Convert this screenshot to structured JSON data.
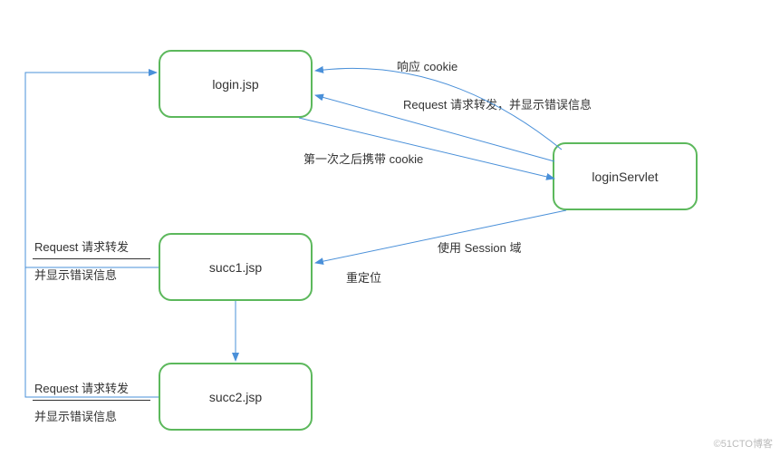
{
  "nodes": {
    "login": "login.jsp",
    "servlet": "loginServlet",
    "succ1": "succ1.jsp",
    "succ2": "succ2.jsp"
  },
  "labels": {
    "responseCookie": "响应 cookie",
    "requestForwardError": "Request 请求转发，并显示错误信息",
    "carryCookie": "第一次之后携带 cookie",
    "useSession": "使用 Session 域",
    "redirect": "重定位",
    "reqForward1a": "Request 请求转发",
    "reqForward1b": "并显示错误信息",
    "reqForward2a": "Request 请求转发",
    "reqForward2b": "并显示错误信息"
  },
  "watermark": "©51CTO博客",
  "colors": {
    "nodeBorder": "#5cb85c",
    "arrow": "#4a90d9"
  }
}
